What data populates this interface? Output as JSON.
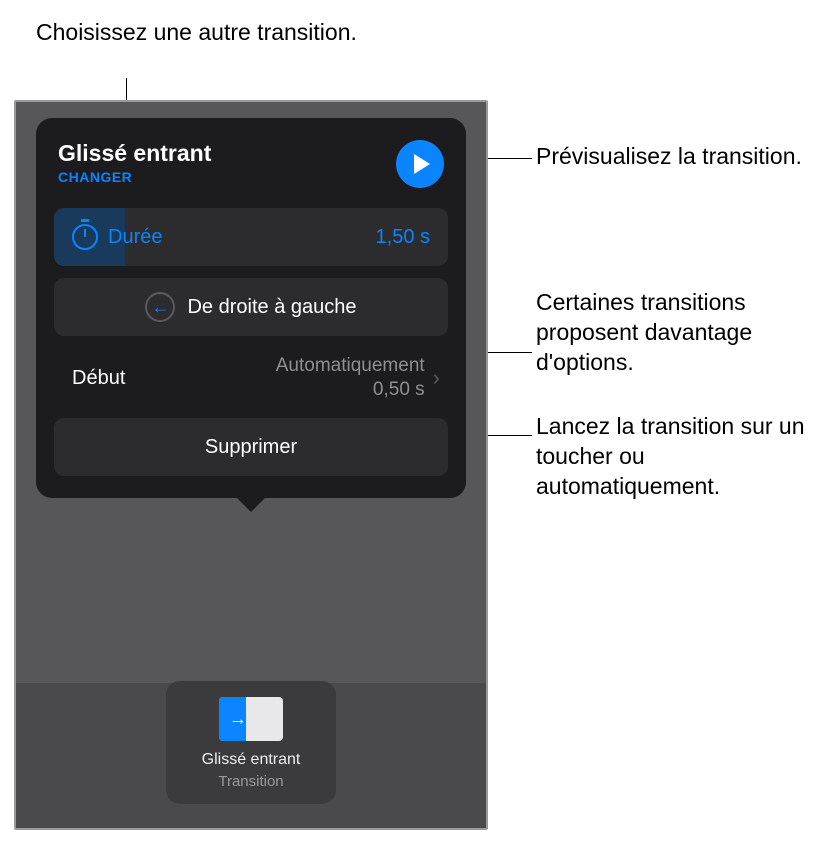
{
  "callouts": {
    "choose": "Choisissez une autre transition.",
    "preview": "Prévisualisez la transition.",
    "options": "Certaines transitions proposent davantage d'options.",
    "start": "Lancez la transition sur un toucher ou automatiquement."
  },
  "popover": {
    "title": "Glissé entrant",
    "change": "CHANGER",
    "duration": {
      "label": "Durée",
      "value": "1,50 s"
    },
    "direction": "De droite à gauche",
    "start": {
      "label": "Début",
      "mode": "Automatiquement",
      "delay": "0,50 s"
    },
    "delete": "Supprimer"
  },
  "thumbnail": {
    "title": "Glissé entrant",
    "subtitle": "Transition"
  }
}
